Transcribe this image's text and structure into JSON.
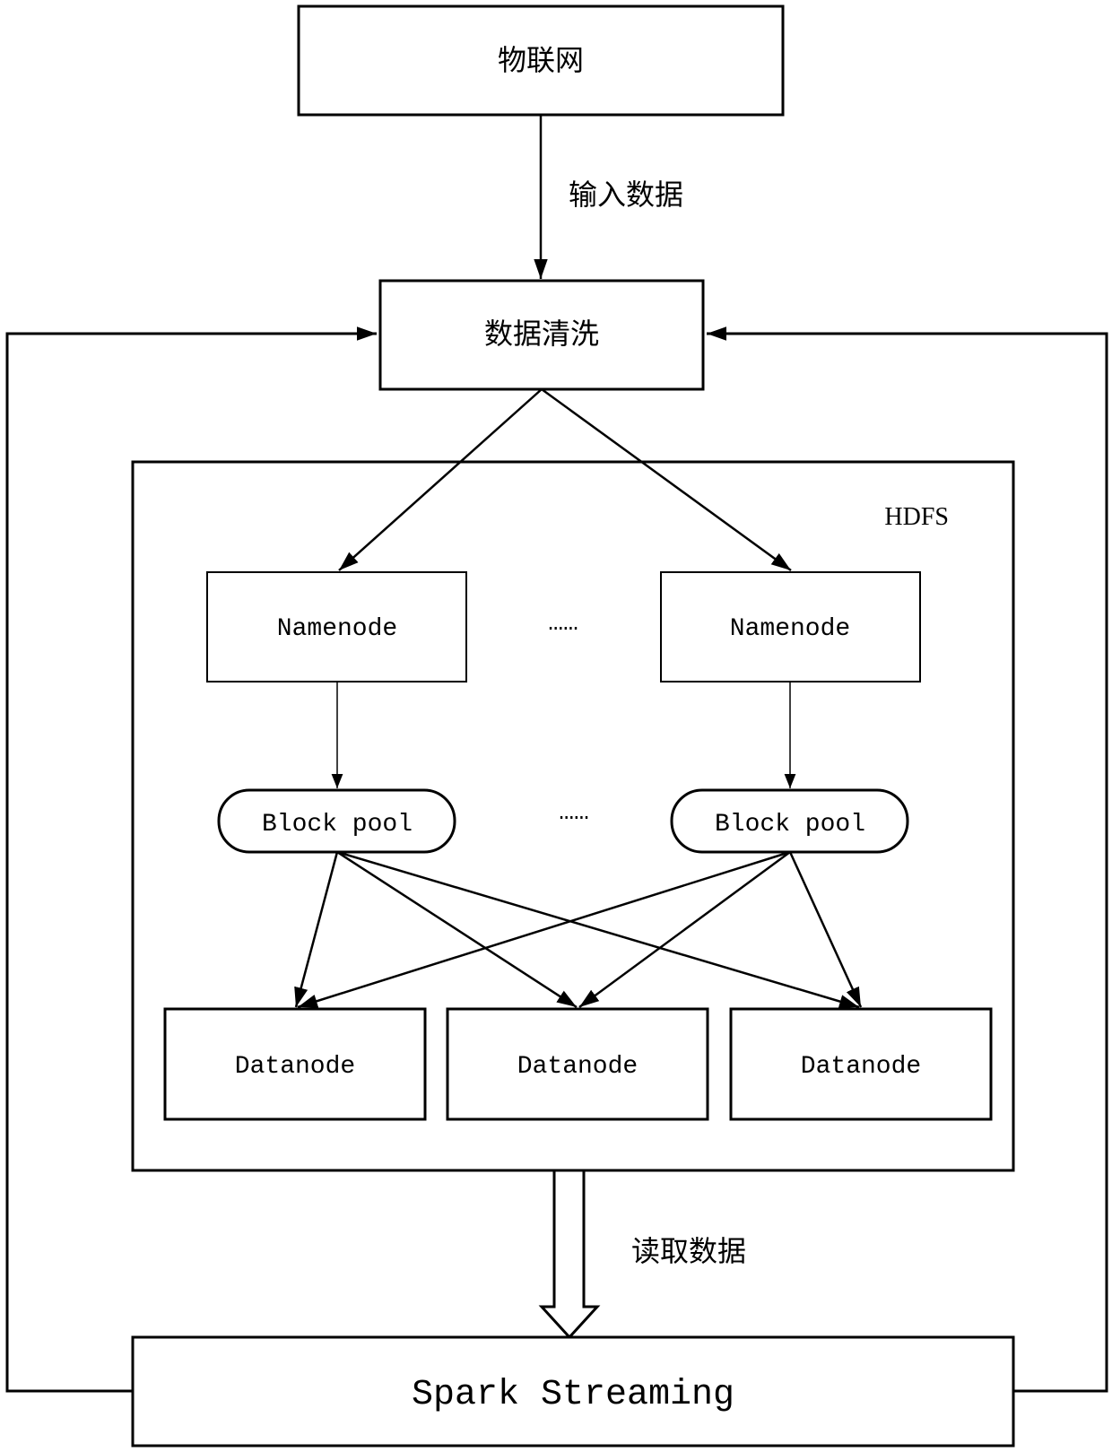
{
  "diagram": {
    "nodes": {
      "iot": {
        "label": "物联网"
      },
      "cleaning": {
        "label": "数据清洗"
      },
      "hdfs": {
        "label": "HDFS"
      },
      "namenode_left": {
        "label": "Namenode"
      },
      "namenode_right": {
        "label": "Namenode"
      },
      "namenode_ellipsis": {
        "label": "……"
      },
      "blockpool_left": {
        "label": "Block pool"
      },
      "blockpool_right": {
        "label": "Block pool"
      },
      "blockpool_ellipsis": {
        "label": "……"
      },
      "datanodes": [
        {
          "label": "Datanode"
        },
        {
          "label": "Datanode"
        },
        {
          "label": "Datanode"
        }
      ],
      "spark": {
        "label": "Spark Streaming"
      }
    },
    "edge_labels": {
      "input_data": "输入数据",
      "read_data": "读取数据"
    },
    "edges": [
      {
        "from": "iot",
        "to": "cleaning",
        "label": "输入数据"
      },
      {
        "from": "cleaning",
        "to": "namenode_left"
      },
      {
        "from": "cleaning",
        "to": "namenode_right"
      },
      {
        "from": "namenode_left",
        "to": "blockpool_left"
      },
      {
        "from": "namenode_right",
        "to": "blockpool_right"
      },
      {
        "from": "blockpool_left",
        "to": "datanode_1"
      },
      {
        "from": "blockpool_left",
        "to": "datanode_2"
      },
      {
        "from": "blockpool_left",
        "to": "datanode_3"
      },
      {
        "from": "blockpool_right",
        "to": "datanode_1"
      },
      {
        "from": "blockpool_right",
        "to": "datanode_2"
      },
      {
        "from": "blockpool_right",
        "to": "datanode_3"
      },
      {
        "from": "hdfs",
        "to": "spark",
        "label": "读取数据",
        "style": "hollow-block-arrow"
      },
      {
        "from": "spark",
        "to": "cleaning",
        "style": "feedback-left"
      },
      {
        "from": "spark",
        "to": "cleaning",
        "style": "feedback-right"
      }
    ]
  }
}
